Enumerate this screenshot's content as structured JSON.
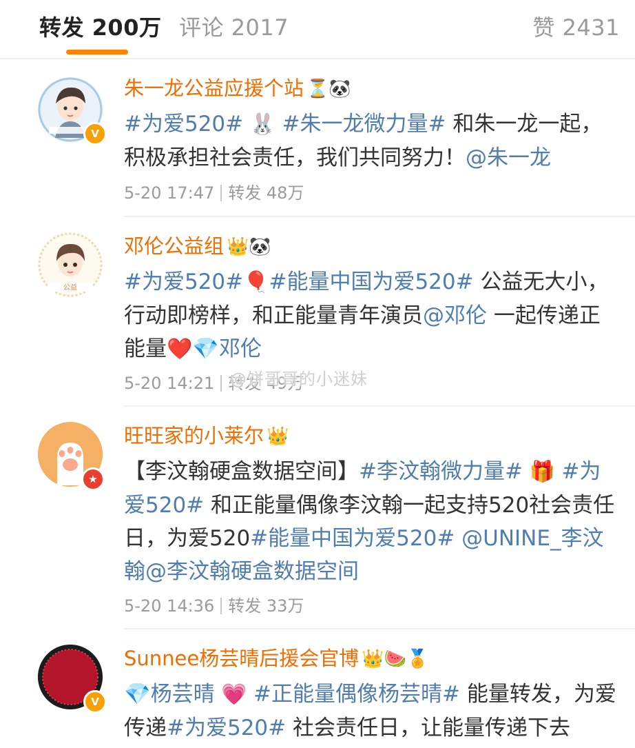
{
  "tabs": {
    "repost_label": "转发",
    "repost_count": "200万",
    "comment_label": "评论",
    "comment_count": "2017",
    "like_label": "赞",
    "like_count": "2431"
  },
  "colors": {
    "accent": "#ff8200",
    "username": "#f26d00",
    "link": "#507daf",
    "meta": "#9b9b9b"
  },
  "posts": [
    {
      "name": "朱一龙公益应援个站",
      "name_emojis": "⏳🐼",
      "segments": [
        "#为爱520#",
        " 🐰 ",
        "#朱一龙微力量#",
        " 和朱一龙一起，积极承担社会责任，我们共同努力！",
        "@朱一龙"
      ],
      "time": "5-20 17:47",
      "repost_label": "转发",
      "repost_count": "48万",
      "avatar_icon": "avatar-cartoon-boy",
      "badge_icon": "verified-v-badge"
    },
    {
      "name": "邓伦公益组",
      "name_emojis": "👑🐼",
      "segments": [
        "#为爱520#",
        "🎈",
        "#能量中国为爱520#",
        " 公益无大小，行动即榜样，和正能量青年演员",
        "@邓伦",
        " 一起传递正能量",
        "❤️",
        "💎邓伦"
      ],
      "time": "5-20 14:21",
      "repost_label": "转发",
      "repost_count": "49万",
      "avatar_icon": "avatar-cartoon-boy"
    },
    {
      "name": "旺旺家的小莱尔",
      "name_emojis": "👑",
      "segments": [
        "【李汶翰硬盒数据空间】",
        "#李汶翰微力量#",
        " 🎁 ",
        "#为爱520#",
        " 和正能量偶像李汶翰一起支持520社会责任日，为爱520",
        "#能量中国为爱520#",
        " @UNINE_李汶翰@李汶翰硬盒数据空间"
      ],
      "time": "5-20 14:36",
      "repost_label": "转发",
      "repost_count": "33万",
      "avatar_icon": "avatar-cat-paw",
      "badge_icon": "member-star-badge"
    },
    {
      "name": "Sunnee杨芸晴后援会官博",
      "name_emojis": "👑🍉🏅",
      "segments": [
        "💎杨芸晴",
        " 💗 ",
        "#正能量偶像杨芸晴#",
        " 能量转发，为爱传递",
        "#为爱520#",
        " 社会责任日，让能量传递下去"
      ],
      "avatar_icon": "avatar-sunnee-star-logo",
      "badge_icon": "verified-v-badge"
    }
  ],
  "watermark": "@饼哥哥的小迷妹"
}
